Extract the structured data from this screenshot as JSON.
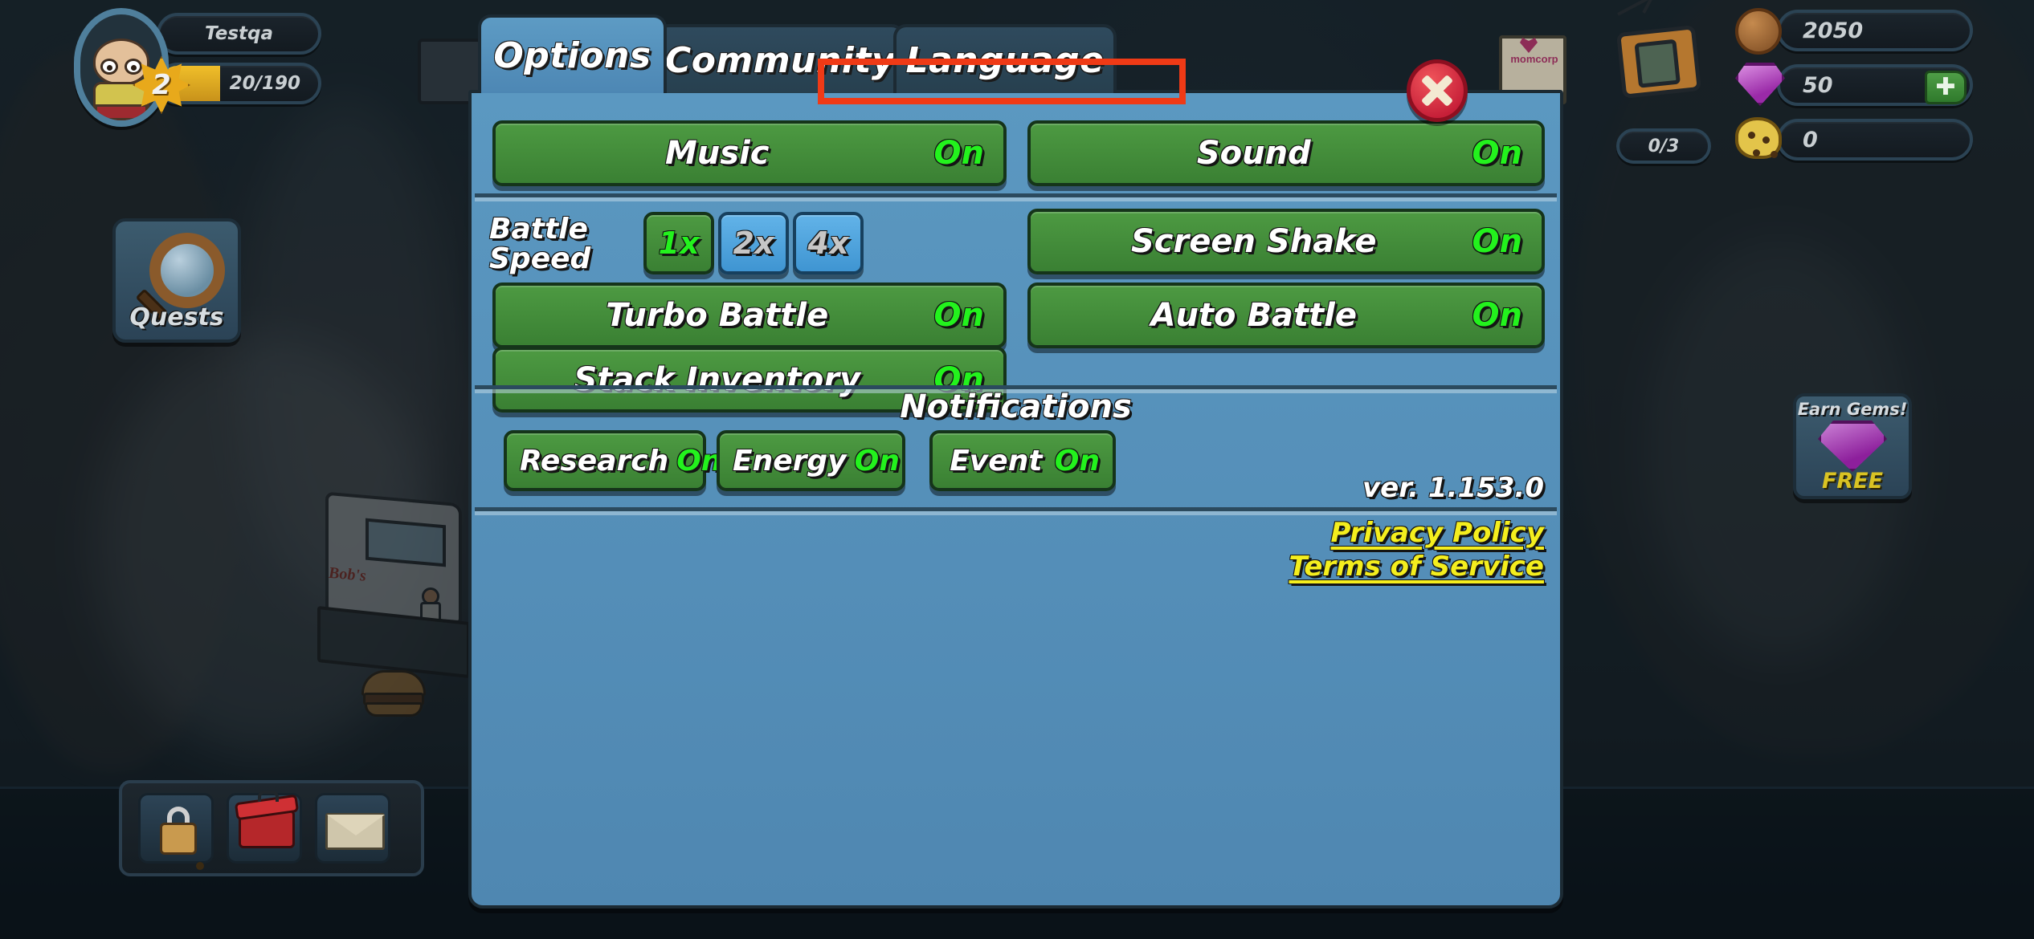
{
  "hud": {
    "player_name": "Testqa",
    "player_level": "2",
    "xp_text": "20/190",
    "quests_label": "Quests",
    "tv_counter": "0/3",
    "currencies": [
      {
        "icon": "coin-icon",
        "value": "2050"
      },
      {
        "icon": "gem-icon",
        "value": "50",
        "has_plus": true
      },
      {
        "icon": "cookie-icon",
        "value": "0"
      }
    ],
    "earn_gems": {
      "title": "Earn Gems!",
      "free_label": "FREE",
      "icon": "gem-icon"
    },
    "bottom_bar_icons": [
      "lock-icon",
      "toolbox-icon",
      "envelope-icon"
    ]
  },
  "dialog": {
    "tabs": [
      {
        "label": "Options",
        "active": true
      },
      {
        "label": "Community",
        "active": false
      },
      {
        "label": "Language",
        "active": false
      }
    ],
    "close_icon": "close-x-icon",
    "toggles_top": [
      {
        "label": "Music",
        "value": "On"
      },
      {
        "label": "Sound",
        "value": "On"
      }
    ],
    "battle_speed": {
      "label": "Battle\nSpeed",
      "label_line1": "Battle",
      "label_line2": "Speed",
      "options": [
        {
          "label": "1x",
          "selected": true
        },
        {
          "label": "2x",
          "selected": false
        },
        {
          "label": "4x",
          "selected": false
        }
      ]
    },
    "toggles_mid": [
      {
        "label": "Screen Shake",
        "value": "On"
      },
      {
        "label": "Turbo Battle",
        "value": "On"
      },
      {
        "label": "Auto Battle",
        "value": "On"
      },
      {
        "label": "Stack Inventory",
        "value": "On"
      }
    ],
    "notifications": {
      "title": "Notifications",
      "items": [
        {
          "label": "Research",
          "value": "On"
        },
        {
          "label": "Energy",
          "value": "On"
        },
        {
          "label": "Event",
          "value": "On"
        }
      ]
    },
    "version": "ver. 1.153.0",
    "footer_links": [
      {
        "label": "Privacy Policy"
      },
      {
        "label": "Terms of Service"
      }
    ]
  },
  "colors": {
    "panel_blue": "#5b98c1",
    "button_green": "#4d9a42",
    "value_green": "#23f21d",
    "link_yellow": "#f4ee1e",
    "annotation_red": "#ef3a16",
    "tab_inactive": "#2f4a5d"
  }
}
